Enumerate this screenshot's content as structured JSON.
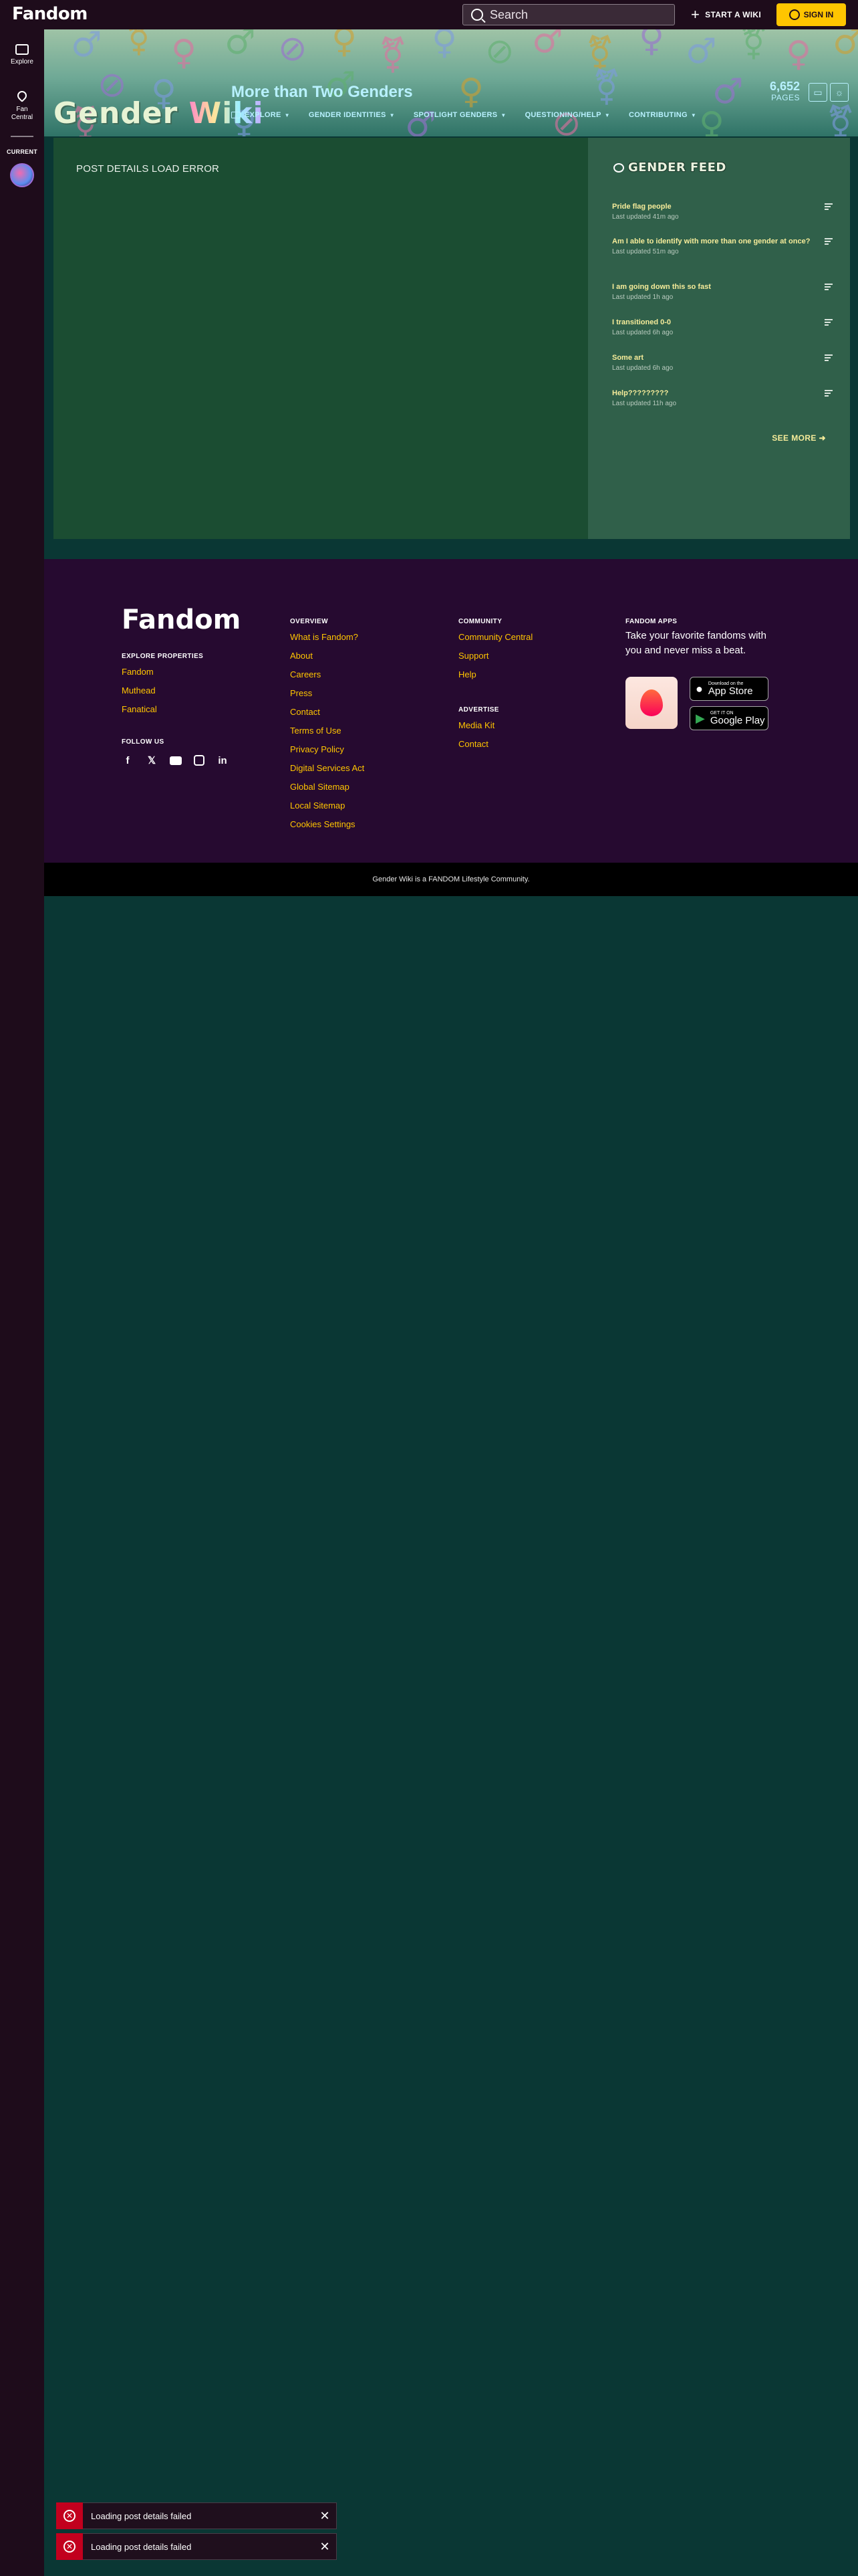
{
  "global_nav": {
    "logo": "Fandom",
    "search_placeholder": "Search",
    "start_wiki": "START A WIKI",
    "sign_in": "SIGN IN"
  },
  "rail": {
    "explore": "Explore",
    "fan_central": "Fan Central",
    "current": "CURRENT"
  },
  "wiki": {
    "title_part1": "Gender",
    "title_part2": "Wiki",
    "tagline": "More than Two Genders",
    "pages_count": "6,652",
    "pages_label": "PAGES",
    "nav": [
      "EXPLORE",
      "GENDER IDENTITIES",
      "SPOTLIGHT GENDERS",
      "QUESTIONING/HELP",
      "CONTRIBUTING"
    ]
  },
  "main": {
    "error_text": "POST DETAILS LOAD ERROR"
  },
  "feed": {
    "heading": "GENDER FEED",
    "items": [
      {
        "title": "Pride flag people",
        "time": "Last updated 41m ago"
      },
      {
        "title": "Am I able to identify with more than one gender at once?",
        "time": "Last updated 51m ago"
      },
      {
        "title": "I am going down this so fast",
        "time": "Last updated 1h ago"
      },
      {
        "title": "I transitioned 0-0",
        "time": "Last updated 6h ago"
      },
      {
        "title": "Some art",
        "time": "Last updated 6h ago"
      },
      {
        "title": "Help?????????",
        "time": "Last updated 11h ago"
      }
    ],
    "see_more": "SEE MORE"
  },
  "footer": {
    "logo": "Fandom",
    "explore_properties": {
      "heading": "EXPLORE PROPERTIES",
      "links": [
        "Fandom",
        "Muthead",
        "Fanatical"
      ]
    },
    "follow_us": "FOLLOW US",
    "social": [
      "f",
      "twitter",
      "youtube",
      "instagram",
      "in"
    ],
    "overview": {
      "heading": "OVERVIEW",
      "links": [
        "What is Fandom?",
        "About",
        "Careers",
        "Press",
        "Contact",
        "Terms of Use",
        "Privacy Policy",
        "Digital Services Act",
        "Global Sitemap",
        "Local Sitemap",
        "Cookies Settings"
      ]
    },
    "community": {
      "heading": "COMMUNITY",
      "links": [
        "Community Central",
        "Support",
        "Help"
      ]
    },
    "advertise": {
      "heading": "ADVERTISE",
      "links": [
        "Media Kit",
        "Contact"
      ]
    },
    "apps": {
      "heading": "FANDOM APPS",
      "text": "Take your favorite fandoms with you and never miss a beat.",
      "app_store_small": "Download on the",
      "app_store_big": "App Store",
      "google_small": "GET IT ON",
      "google_big": "Google Play"
    },
    "legal": "Gender Wiki is a FANDOM Lifestyle Community."
  },
  "toasts": [
    "Loading post details failed",
    "Loading post details failed"
  ],
  "colors": {
    "accent": "#ffc500",
    "fandom_red": "#fa005a",
    "error": "#c2001e"
  }
}
